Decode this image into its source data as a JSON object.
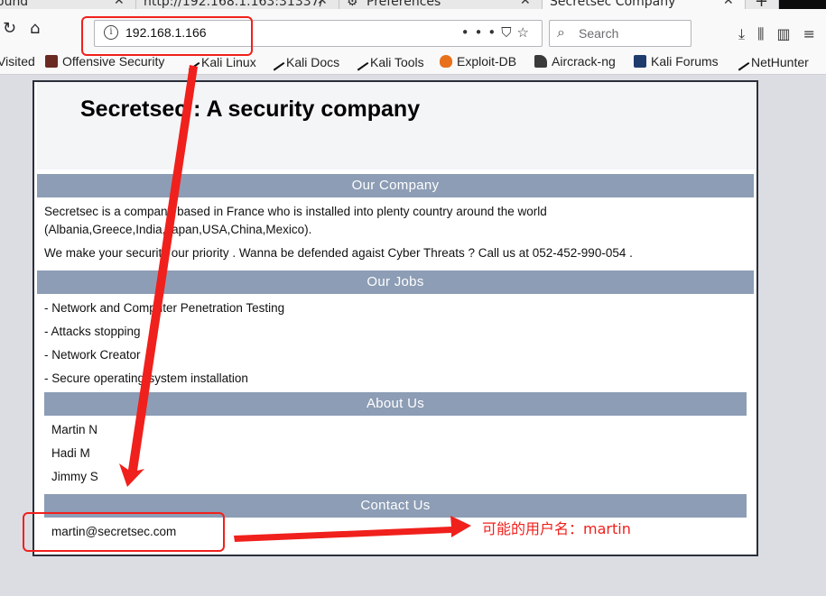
{
  "browser": {
    "tabs": [
      {
        "title": "ound",
        "close": "✕"
      },
      {
        "title": "http://192.168.1.163:31337/",
        "close": "✕"
      },
      {
        "title": "Preferences",
        "close": "✕"
      },
      {
        "title": "Secretsec Company",
        "close": "✕"
      }
    ],
    "new_tab": "+",
    "url": "192.168.1.166",
    "search_placeholder": "Search",
    "bookmarks": [
      "Visited",
      "Offensive Security",
      "Kali Linux",
      "Kali Docs",
      "Kali Tools",
      "Exploit-DB",
      "Aircrack-ng",
      "Kali Forums",
      "NetHunter"
    ]
  },
  "page": {
    "title": "Secretsec : A security company",
    "sections": {
      "company": {
        "heading": "Our Company",
        "lines": [
          "Secretsec is a company based in France who is installed into plenty country around the world",
          "(Albania,Greece,India,Japan,USA,China,Mexico).",
          "We make your security our priority . Wanna be defended agaist Cyber Threats ? Call us at 052-452-990-054 ."
        ]
      },
      "jobs": {
        "heading": "Our Jobs",
        "items": [
          "- Network and Computer Penetration Testing",
          "- Attacks stopping",
          "- Network Creator",
          "- Secure operating-system installation"
        ]
      },
      "about": {
        "heading": "About Us",
        "people": [
          "Martin N",
          "Hadi M",
          "Jimmy S"
        ]
      },
      "contact": {
        "heading": "Contact Us",
        "email": "martin@secretsec.com"
      }
    }
  },
  "annotation": {
    "note": "可能的用户名：martin",
    "color": "#f0201c"
  }
}
